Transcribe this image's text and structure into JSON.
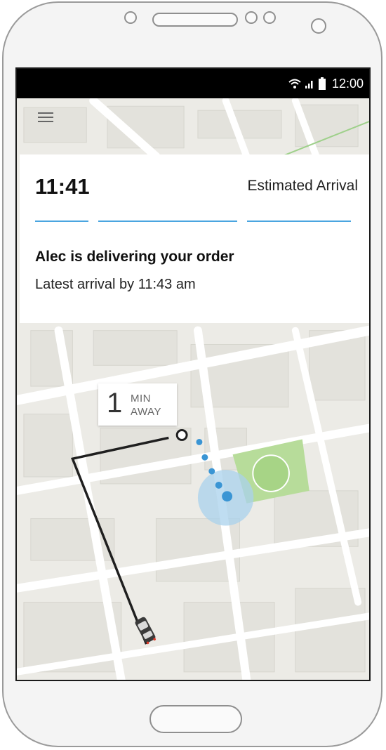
{
  "status_bar": {
    "time": "12:00",
    "icons": [
      "wifi-icon",
      "signal-icon",
      "battery-icon"
    ]
  },
  "delivery_card": {
    "eta_time": "11:41",
    "eta_label": "Estimated Arrival",
    "title": "Alec is delivering your order",
    "subtitle": "Latest arrival by 11:43 am"
  },
  "map": {
    "away_number": "1",
    "away_unit_line1": "MIN",
    "away_unit_line2": "AWAY",
    "colors": {
      "route": "#1f1f1f",
      "location_dot": "#3a95d4",
      "location_halo": "#a9d2ec",
      "park": "#b7dc9a",
      "progress_bar": "#4aa5e0"
    }
  }
}
